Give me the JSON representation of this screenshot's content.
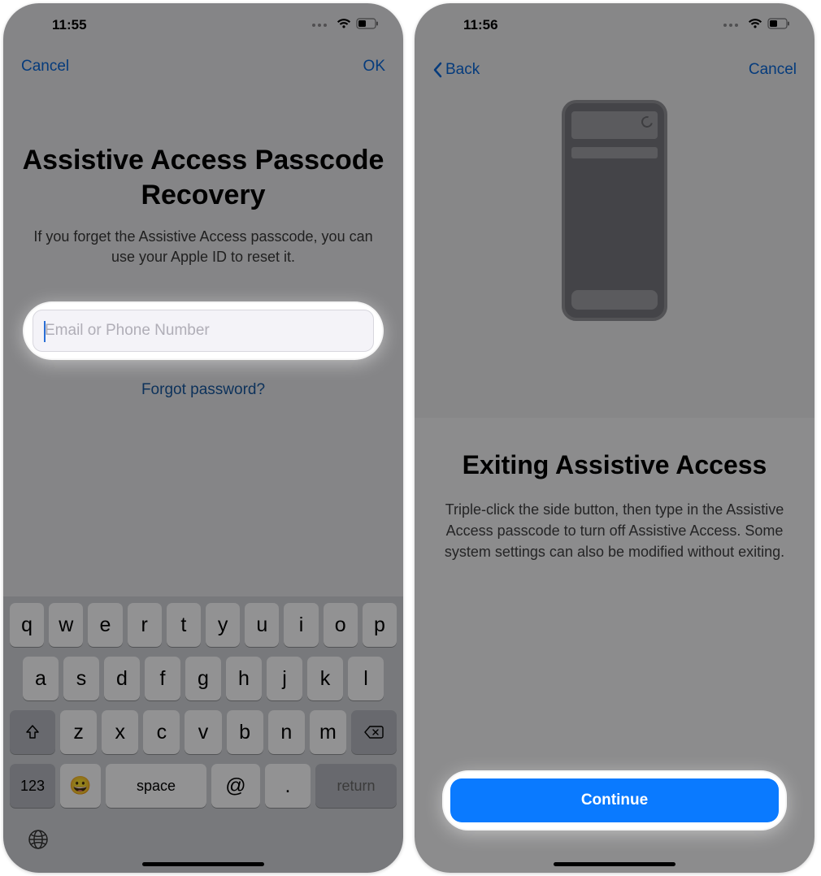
{
  "left": {
    "status": {
      "time": "11:55"
    },
    "nav": {
      "cancel": "Cancel",
      "ok": "OK"
    },
    "title": "Assistive Access Passcode Recovery",
    "subtitle": "If you forget the Assistive Access passcode, you can use your Apple ID to reset it.",
    "input_placeholder": "Email or Phone Number",
    "forgot": "Forgot password?",
    "keyboard": {
      "row1": [
        "q",
        "w",
        "e",
        "r",
        "t",
        "y",
        "u",
        "i",
        "o",
        "p"
      ],
      "row2": [
        "a",
        "s",
        "d",
        "f",
        "g",
        "h",
        "j",
        "k",
        "l"
      ],
      "row3": [
        "z",
        "x",
        "c",
        "v",
        "b",
        "n",
        "m"
      ],
      "num": "123",
      "space": "space",
      "at": "@",
      "dot": ".",
      "return": "return"
    }
  },
  "right": {
    "status": {
      "time": "11:56"
    },
    "nav": {
      "back": "Back",
      "cancel": "Cancel"
    },
    "title": "Exiting Assistive Access",
    "subtitle": "Triple-click the side button, then type in the Assistive Access passcode to turn off Assistive Access. Some system settings can also be modified without exiting.",
    "continue": "Continue"
  }
}
